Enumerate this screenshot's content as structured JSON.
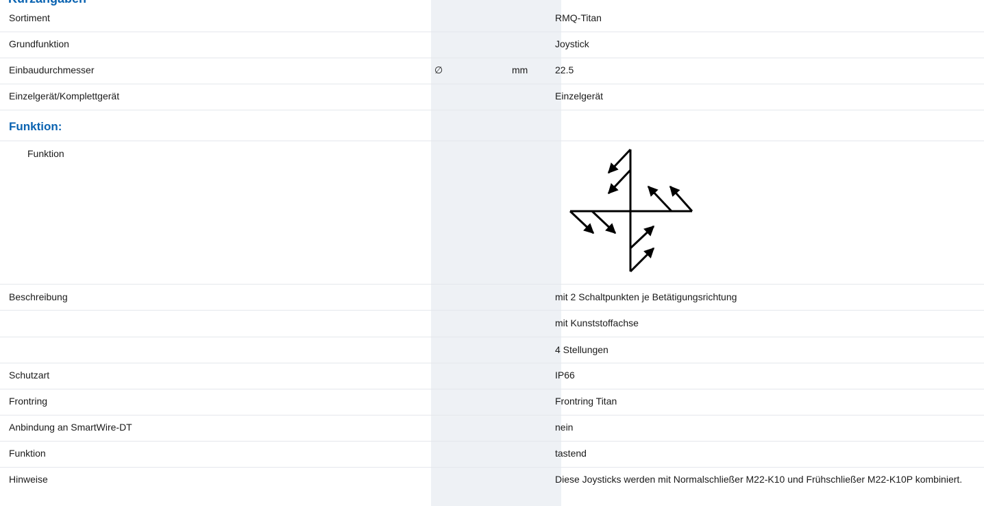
{
  "cut_heading": "Kurzangaben",
  "rows": [
    {
      "label": "Sortiment",
      "value": "RMQ-Titan"
    },
    {
      "label": "Grundfunktion",
      "value": "Joystick"
    },
    {
      "label": "Einbaudurchmesser",
      "symbol": "∅",
      "unit": "mm",
      "value": "22.5"
    },
    {
      "label": "Einzelgerät/Komplettgerät",
      "value": "Einzelgerät"
    }
  ],
  "funktion_section": {
    "title": "Funktion:",
    "label": "Funktion",
    "diagram_icon": "joystick-function-symbol-icon"
  },
  "details": [
    {
      "label": "Beschreibung",
      "value": "mit 2 Schaltpunkten je Betätigungsrichtung"
    },
    {
      "label": "",
      "value": "mit Kunststoffachse"
    },
    {
      "label": "",
      "value": "4 Stellungen"
    },
    {
      "label": "Schutzart",
      "value": "IP66"
    },
    {
      "label": "Frontring",
      "value": "Frontring Titan"
    },
    {
      "label": "Anbindung an SmartWire-DT",
      "value": "nein"
    },
    {
      "label": "Funktion",
      "value": "tastend"
    },
    {
      "label": "Hinweise",
      "value": "Diese Joysticks werden mit Normalschließer M22-K10 und Frühschließer M22-K10P kombiniert."
    }
  ],
  "colors": {
    "section_blue": "#0a63b1",
    "shade": "#eef1f5",
    "divider": "#e4e7ec"
  }
}
